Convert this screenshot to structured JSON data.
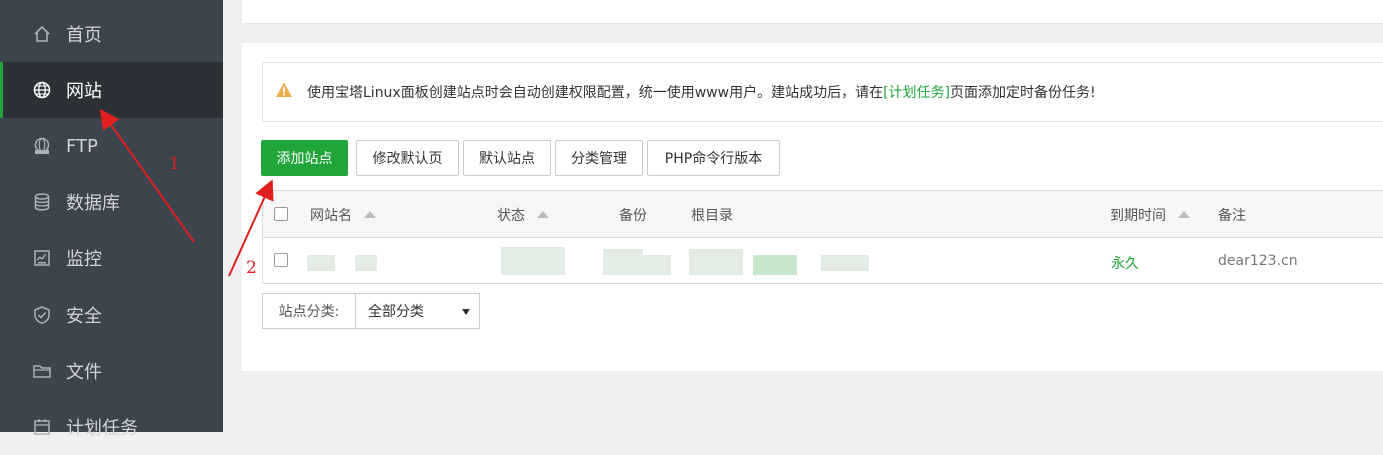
{
  "sidebar": {
    "items": [
      {
        "label": "首页",
        "icon": "home-icon"
      },
      {
        "label": "网站",
        "icon": "globe-icon",
        "active": true
      },
      {
        "label": "FTP",
        "icon": "ftp-icon"
      },
      {
        "label": "数据库",
        "icon": "database-icon"
      },
      {
        "label": "监控",
        "icon": "monitor-icon"
      },
      {
        "label": "安全",
        "icon": "shield-icon"
      },
      {
        "label": "文件",
        "icon": "folder-icon"
      },
      {
        "label": "计划任务",
        "icon": "calendar-icon"
      }
    ]
  },
  "notice": {
    "text_before": "使用宝塔Linux面板创建站点时会自动创建权限配置，统一使用www用户。建站成功后，请在",
    "link": "[计划任务]",
    "text_after": "页面添加定时备份任务!",
    "icon": "warning-icon"
  },
  "toolbar": {
    "add_site": "添加站点",
    "edit_default_page": "修改默认页",
    "default_site": "默认站点",
    "category_manage": "分类管理",
    "php_cli_version": "PHP命令行版本"
  },
  "table": {
    "headers": {
      "site_name": "网站名",
      "status": "状态",
      "backup": "备份",
      "root_dir": "根目录",
      "expire": "到期时间",
      "remark": "备注"
    },
    "rows": [
      {
        "expire": "永久",
        "remark": "dear123.cn"
      }
    ]
  },
  "category": {
    "label": "站点分类:",
    "selected": "全部分类"
  },
  "annotations": {
    "label_1": "1",
    "label_2": "2"
  },
  "colors": {
    "sidebar_bg": "#3c444d",
    "sidebar_active_bg": "#2c3138",
    "brand_green": "#20a53a",
    "warning": "#f0ad4e",
    "annotation_red": "#e0201f"
  }
}
